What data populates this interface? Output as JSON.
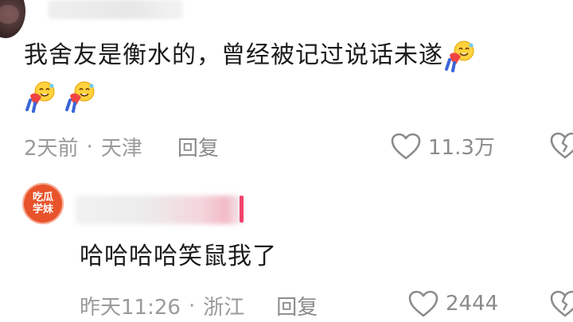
{
  "first_comment": {
    "text": "我舍友是衡水的，曾经被记过说话未遂",
    "emoji_name": "bowing-face-emoji",
    "meta": {
      "time": "2天前",
      "separator": "·",
      "location": "天津",
      "reply_label": "回复"
    },
    "likes": {
      "count": "11.3万",
      "icon": "heart-outline-icon"
    },
    "dislike_icon": "broken-heart-icon"
  },
  "second_comment": {
    "avatar": {
      "line1": "吃瓜",
      "line2": "学妹",
      "color": "#e8532b"
    },
    "text": "哈哈哈哈笑鼠我了",
    "meta": {
      "time": "昨天11:26",
      "separator": "·",
      "location": "浙江",
      "reply_label": "回复"
    },
    "likes": {
      "count": "2444",
      "icon": "heart-outline-icon"
    },
    "dislike_icon": "broken-heart-icon"
  },
  "colors": {
    "text": "#1b1b1b",
    "meta": "#9a9a9a",
    "accent": "#f0436a"
  }
}
